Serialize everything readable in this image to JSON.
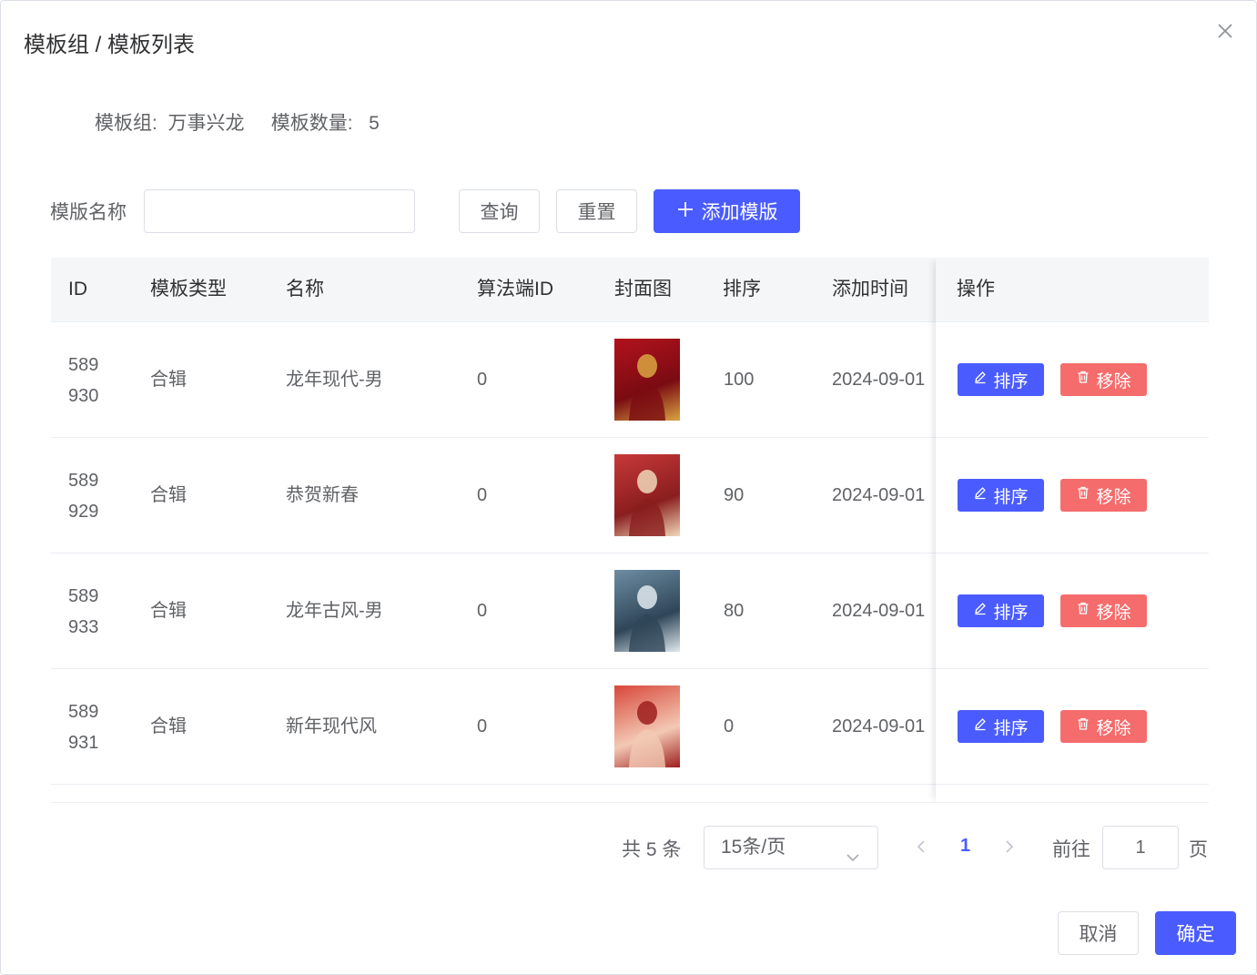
{
  "dialog": {
    "title": "模板组 / 模板列表"
  },
  "info": {
    "group_label": "模板组:",
    "group_value": "万事兴龙",
    "count_label": "模板数量:",
    "count_value": "5"
  },
  "search": {
    "label": "模版名称",
    "value": "",
    "placeholder": "",
    "query_label": "查询",
    "reset_label": "重置",
    "add_label": "添加模版"
  },
  "table": {
    "headers": {
      "id": "ID",
      "type": "模板类型",
      "name": "名称",
      "algo_id": "算法端ID",
      "cover": "封面图",
      "sort": "排序",
      "added_time": "添加时间",
      "actions": "操作"
    },
    "rows": [
      {
        "id_line1": "589",
        "id_line2": "930",
        "type": "合辑",
        "name": "龙年现代-男",
        "algo_id": "0",
        "sort": "100",
        "added_time": "2024-09-01",
        "sort_btn": "排序",
        "remove_btn": "移除",
        "cover_colors": [
          "#b3121c",
          "#7a0b12",
          "#d9a441"
        ]
      },
      {
        "id_line1": "589",
        "id_line2": "929",
        "type": "合辑",
        "name": "恭贺新春",
        "algo_id": "0",
        "sort": "90",
        "added_time": "2024-09-01",
        "sort_btn": "排序",
        "remove_btn": "移除",
        "cover_colors": [
          "#c8383a",
          "#8a1e1e",
          "#f0d7b8"
        ]
      },
      {
        "id_line1": "589",
        "id_line2": "933",
        "type": "合辑",
        "name": "龙年古风-男",
        "algo_id": "0",
        "sort": "80",
        "added_time": "2024-09-01",
        "sort_btn": "排序",
        "remove_btn": "移除",
        "cover_colors": [
          "#6d8da3",
          "#2f4658",
          "#dfe8ee"
        ]
      },
      {
        "id_line1": "589",
        "id_line2": "931",
        "type": "合辑",
        "name": "新年现代风",
        "algo_id": "0",
        "sort": "0",
        "added_time": "2024-09-01",
        "sort_btn": "排序",
        "remove_btn": "移除",
        "cover_colors": [
          "#d8473a",
          "#f3c9b4",
          "#9e1f1f"
        ]
      }
    ]
  },
  "pagination": {
    "total_text": "共 5 条",
    "page_size": "15条/页",
    "current_page": "1",
    "goto_label": "前往",
    "goto_value": "1",
    "goto_suffix": "页"
  },
  "footer": {
    "cancel_label": "取消",
    "ok_label": "确定"
  },
  "colors": {
    "primary": "#4a5cff",
    "danger": "#f56c6c"
  }
}
